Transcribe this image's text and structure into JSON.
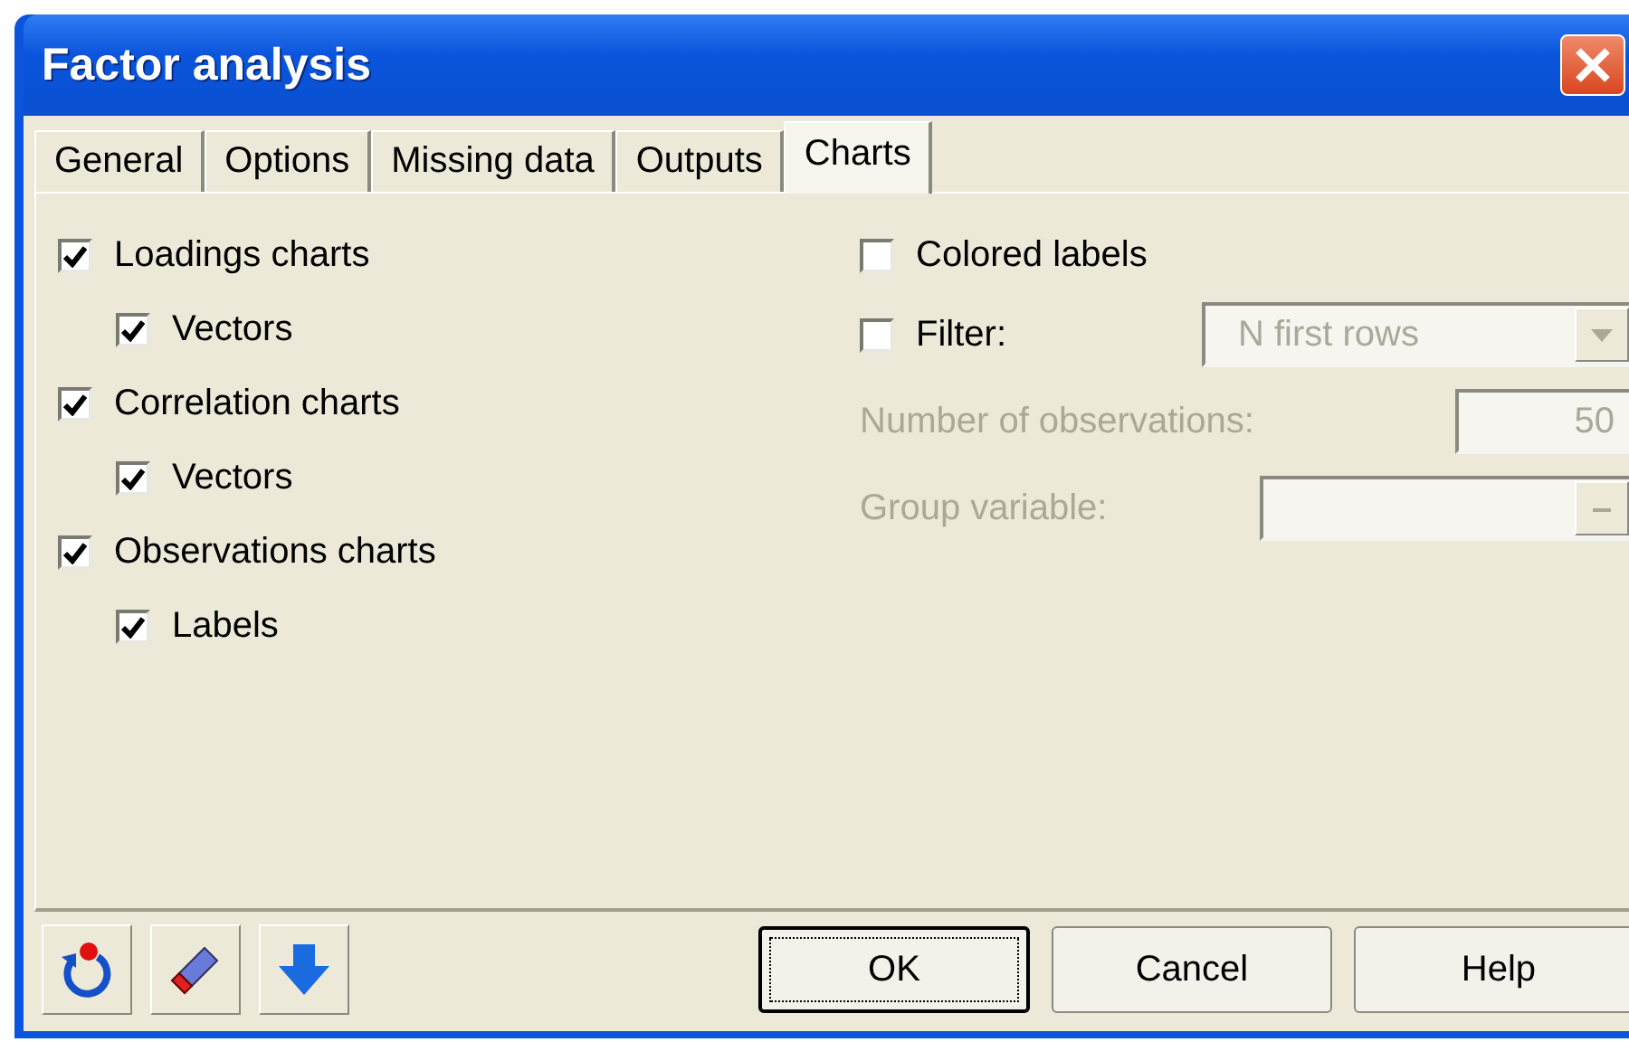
{
  "window": {
    "title": "Factor analysis"
  },
  "tabs": [
    {
      "label": "General",
      "selected": false
    },
    {
      "label": "Options",
      "selected": false
    },
    {
      "label": "Missing data",
      "selected": false
    },
    {
      "label": "Outputs",
      "selected": false
    },
    {
      "label": "Charts",
      "selected": true
    }
  ],
  "chart_options": [
    {
      "label": "Loadings charts",
      "checked": true,
      "children": [
        {
          "label": "Vectors",
          "checked": true
        }
      ]
    },
    {
      "label": "Correlation charts",
      "checked": true,
      "children": [
        {
          "label": "Vectors",
          "checked": true
        }
      ]
    },
    {
      "label": "Observations charts",
      "checked": true,
      "children": [
        {
          "label": "Labels",
          "checked": true
        }
      ]
    }
  ],
  "colored_labels": {
    "label": "Colored labels",
    "checked": false
  },
  "filter": {
    "label": "Filter:",
    "checked": false,
    "dropdown": {
      "value": "N first rows",
      "disabled": true
    }
  },
  "number_of_observations": {
    "label": "Number of observations:",
    "value": "50",
    "disabled": true
  },
  "group_variable": {
    "label": "Group variable:",
    "disabled": true
  },
  "buttons": [
    {
      "label": "OK",
      "default": true
    },
    {
      "label": "Cancel",
      "default": false
    },
    {
      "label": "Help",
      "default": false
    }
  ]
}
